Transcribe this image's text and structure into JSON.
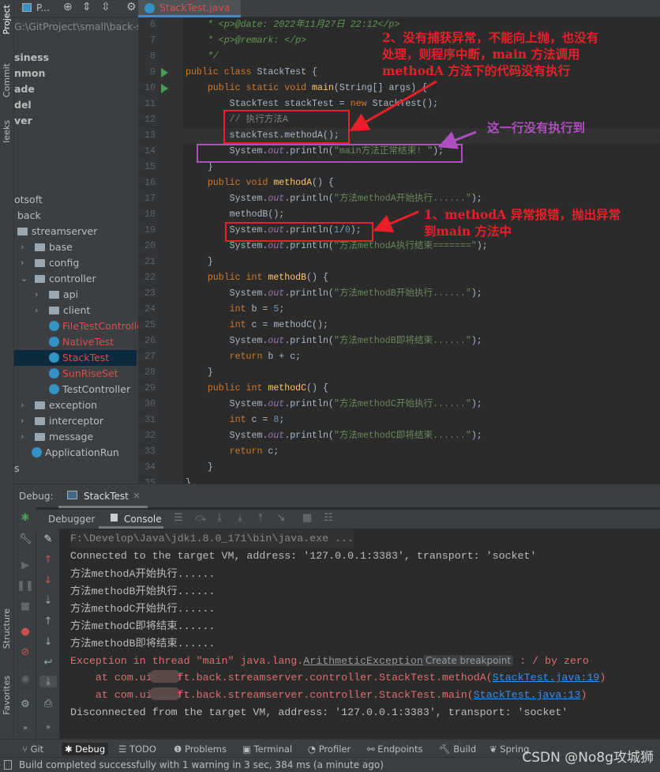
{
  "left_strip": {
    "project": "Project",
    "commit": "Commit",
    "leeks": "leeks",
    "structure": "Structure",
    "favorites": "Favorites"
  },
  "project_panel": {
    "dropdown": "P...",
    "path": "G:\\GitProject\\small\\back-str",
    "items": [
      {
        "label": "siness",
        "bold": true
      },
      {
        "label": "nmon",
        "bold": true
      },
      {
        "label": "ade",
        "bold": true
      },
      {
        "label": "del",
        "bold": true
      },
      {
        "label": "ver",
        "bold": true
      },
      {
        "label": "otsoft"
      },
      {
        "label": "back"
      },
      {
        "label": "streamserver"
      },
      {
        "label": "base"
      },
      {
        "label": "config"
      },
      {
        "label": "controller"
      },
      {
        "label": "api"
      },
      {
        "label": "client"
      },
      {
        "label": "FileTestControlle"
      },
      {
        "label": "NativeTest"
      },
      {
        "label": "StackTest"
      },
      {
        "label": "SunRiseSet"
      },
      {
        "label": "TestController"
      },
      {
        "label": "exception"
      },
      {
        "label": "interceptor"
      },
      {
        "label": "message"
      },
      {
        "label": "ApplicationRun"
      },
      {
        "label": "s"
      }
    ]
  },
  "editor": {
    "tab": "StackTest.java",
    "lines": [
      {
        "n": "6",
        "t": [
          [
            "    * <p>@date: 2022年11月27日 22:12</p>",
            "doc"
          ]
        ]
      },
      {
        "n": "7",
        "t": [
          [
            "    * <p>@remark: </p>",
            "doc"
          ]
        ]
      },
      {
        "n": "8",
        "t": [
          [
            "    */",
            "doc"
          ]
        ]
      },
      {
        "n": "9",
        "t": [
          [
            "public class ",
            "kw"
          ],
          [
            "StackTest {",
            ""
          ]
        ]
      },
      {
        "n": "10",
        "t": [
          [
            "    public static void ",
            "kw"
          ],
          [
            "main",
            "fn"
          ],
          [
            "(String[] args) {",
            ""
          ]
        ]
      },
      {
        "n": "11",
        "t": [
          [
            "        StackTest stackTest = ",
            ""
          ],
          [
            "new ",
            "kw"
          ],
          [
            "StackTest();",
            ""
          ]
        ]
      },
      {
        "n": "12",
        "t": [
          [
            "        // 执行方法A",
            "cm"
          ]
        ]
      },
      {
        "n": "13",
        "t": [
          [
            "        stackTest.methodA();",
            ""
          ]
        ]
      },
      {
        "n": "14",
        "t": [
          [
            "        System.",
            ""
          ],
          [
            "out",
            "fld"
          ],
          [
            ".println(",
            ""
          ],
          [
            "\"main方法正常结束! \"",
            "str"
          ],
          [
            ");",
            ""
          ]
        ]
      },
      {
        "n": "15",
        "t": [
          [
            "    }",
            ""
          ]
        ]
      },
      {
        "n": "16",
        "t": [
          [
            "    public void ",
            "kw"
          ],
          [
            "methodA",
            "fn"
          ],
          [
            "() {",
            ""
          ]
        ]
      },
      {
        "n": "17",
        "t": [
          [
            "        System.",
            ""
          ],
          [
            "out",
            "fld"
          ],
          [
            ".println(",
            ""
          ],
          [
            "\"方法methodA开始执行......\"",
            "str"
          ],
          [
            ");",
            ""
          ]
        ]
      },
      {
        "n": "18",
        "t": [
          [
            "        methodB();",
            ""
          ]
        ]
      },
      {
        "n": "19",
        "t": [
          [
            "        System.",
            ""
          ],
          [
            "out",
            "fld"
          ],
          [
            ".println(",
            ""
          ],
          [
            "1",
            "num"
          ],
          [
            "/",
            ""
          ],
          [
            "0",
            "num"
          ],
          [
            ");",
            ""
          ]
        ]
      },
      {
        "n": "20",
        "t": [
          [
            "        System.",
            ""
          ],
          [
            "out",
            "fld"
          ],
          [
            ".println(",
            ""
          ],
          [
            "\"方法methodA执行结束=======\"",
            "str"
          ],
          [
            ");",
            ""
          ]
        ]
      },
      {
        "n": "21",
        "t": [
          [
            "    }",
            ""
          ]
        ]
      },
      {
        "n": "22",
        "t": [
          [
            "    public int ",
            "kw"
          ],
          [
            "methodB",
            "fn"
          ],
          [
            "() {",
            ""
          ]
        ]
      },
      {
        "n": "23",
        "t": [
          [
            "        System.",
            ""
          ],
          [
            "out",
            "fld"
          ],
          [
            ".println(",
            ""
          ],
          [
            "\"方法methodB开始执行......\"",
            "str"
          ],
          [
            ");",
            ""
          ]
        ]
      },
      {
        "n": "24",
        "t": [
          [
            "        int ",
            "kw"
          ],
          [
            "b = ",
            ""
          ],
          [
            "5",
            "num"
          ],
          [
            ";",
            ""
          ]
        ]
      },
      {
        "n": "25",
        "t": [
          [
            "        int ",
            "kw"
          ],
          [
            "c = methodC();",
            ""
          ]
        ]
      },
      {
        "n": "26",
        "t": [
          [
            "        System.",
            ""
          ],
          [
            "out",
            "fld"
          ],
          [
            ".println(",
            ""
          ],
          [
            "\"方法methodB即将结束......\"",
            "str"
          ],
          [
            ");",
            ""
          ]
        ]
      },
      {
        "n": "27",
        "t": [
          [
            "        return ",
            "kw"
          ],
          [
            "b + c;",
            ""
          ]
        ]
      },
      {
        "n": "28",
        "t": [
          [
            "    }",
            ""
          ]
        ]
      },
      {
        "n": "29",
        "t": [
          [
            "    public int ",
            "kw"
          ],
          [
            "methodC",
            "fn"
          ],
          [
            "() {",
            ""
          ]
        ]
      },
      {
        "n": "30",
        "t": [
          [
            "        System.",
            ""
          ],
          [
            "out",
            "fld"
          ],
          [
            ".println(",
            ""
          ],
          [
            "\"方法methodC开始执行......\"",
            "str"
          ],
          [
            ");",
            ""
          ]
        ]
      },
      {
        "n": "31",
        "t": [
          [
            "        int ",
            "kw"
          ],
          [
            "c = ",
            ""
          ],
          [
            "8",
            "num"
          ],
          [
            ";",
            ""
          ]
        ]
      },
      {
        "n": "32",
        "t": [
          [
            "        System.",
            ""
          ],
          [
            "out",
            "fld"
          ],
          [
            ".println(",
            ""
          ],
          [
            "\"方法methodC即将结束......\"",
            "str"
          ],
          [
            ");",
            ""
          ]
        ]
      },
      {
        "n": "33",
        "t": [
          [
            "        return ",
            "kw"
          ],
          [
            "c;",
            ""
          ]
        ]
      },
      {
        "n": "34",
        "t": [
          [
            "    }",
            ""
          ]
        ]
      },
      {
        "n": "35",
        "t": [
          [
            "}",
            ""
          ]
        ]
      }
    ]
  },
  "annotations": {
    "note2": [
      "2、没有捕获异常，不能向上抛，也没有",
      "处理，则程序中断，main 方法调用",
      "methodA 方法下的代码没有执行"
    ],
    "note_purple": "这一行没有执行到",
    "note1": [
      "1、methodA 异常报错，抛出异常",
      "到main 方法中"
    ],
    "red": "#e8202a",
    "purple": "#b04fc0"
  },
  "debug": {
    "label": "Debug:",
    "session_tab": "StackTest",
    "tabs": {
      "debugger": "Debugger",
      "console": "Console"
    },
    "console": {
      "cmd": "F:\\Develop\\Java\\jdk1.8.0_171\\bin\\java.exe ...",
      "connected": "Connected to the target VM, address: '127.0.0.1:3383', transport: 'socket'",
      "output": [
        "方法methodA开始执行......",
        "方法methodB开始执行......",
        "方法methodC开始执行......",
        "方法methodC即将结束......",
        "方法methodB即将结束......"
      ],
      "exception": {
        "prefix": "Exception in thread \"main\" java.lang.",
        "class": "ArithmeticException",
        "breakpoint": "Create breakpoint",
        "suffix": " : / by zero"
      },
      "trace": [
        {
          "pre": "    at com.ui",
          "post": "ft.back.streamserver.controller.StackTest.methodA(",
          "link": "StackTest.java:19",
          "end": ")"
        },
        {
          "pre": "    at com.ui",
          "post": "ft.back.streamserver.controller.StackTest.main(",
          "link": "StackTest.java:13",
          "end": ")"
        }
      ],
      "disconnected": "Disconnected from the target VM, address: '127.0.0.1:3383', transport: 'socket'"
    }
  },
  "bottom_tabs": [
    "Git",
    "Debug",
    "TODO",
    "Problems",
    "Terminal",
    "Profiler",
    "Endpoints",
    "Build",
    "Spring"
  ],
  "status": "Build completed successfully with 1 warning in 3 sec, 384 ms (a minute ago)",
  "watermark": "CSDN @No8g攻城狮"
}
